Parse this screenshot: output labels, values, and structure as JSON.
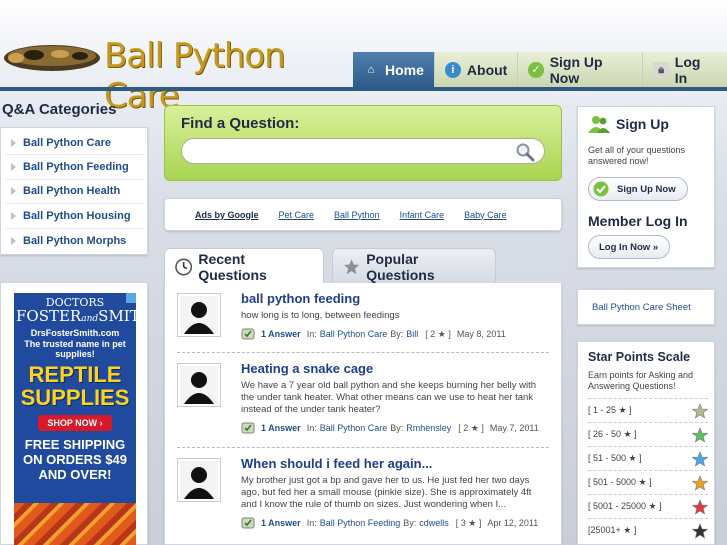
{
  "header": {
    "site_title": "Ball Python Care",
    "nav": [
      {
        "label": "Home",
        "icon": "home-icon",
        "active": true
      },
      {
        "label": "About",
        "icon": "info-icon",
        "active": false
      },
      {
        "label": "Sign Up Now",
        "icon": "check-icon",
        "active": false
      },
      {
        "label": "Log In",
        "icon": "lock-icon",
        "active": false
      }
    ]
  },
  "sidebar": {
    "categories_title": "Q&A Categories",
    "categories": [
      "Ball Python Care",
      "Ball Python Feeding",
      "Ball Python Health",
      "Ball Python Housing",
      "Ball Python Morphs"
    ],
    "ad": {
      "brand_line1": "DOCTORS",
      "brand_line2": "FOSTER",
      "brand_and": "and",
      "brand_line3": "SMITH",
      "url": "DrsFosterSmith.com",
      "tagline": "The trusted name in pet supplies!",
      "headline1": "REPTILE",
      "headline2": "SUPPLIES",
      "shop_button": "SHOP NOW ›",
      "offer": "FREE SHIPPING ON ORDERS $49 AND OVER!"
    }
  },
  "find": {
    "label": "Find a Question:",
    "search_value": ""
  },
  "ads_bar": {
    "ads_by": "Ads by Google",
    "links": [
      "Pet Care",
      "Ball Python",
      "Infant Care",
      "Baby Care"
    ]
  },
  "tabs": {
    "recent": "Recent Questions",
    "popular": "Popular Questions"
  },
  "questions": [
    {
      "title": "ball python feeding",
      "body": "how long is to long, between feedings",
      "answers": "1 Answer",
      "in_label": "In:",
      "category": "Ball Python Care",
      "by_label": "By:",
      "author": "Bill",
      "points": "[ 2 ★ ]",
      "date": "May 8, 2011"
    },
    {
      "title": "Heating a snake cage",
      "body": "We have a 7 year old ball python and she keeps burning her belly with the under tank heater. What other means can we use to heat her tank instead of the under tank heater?",
      "answers": "1 Answer",
      "in_label": "In:",
      "category": "Ball Python Care",
      "by_label": "By:",
      "author": "Rmhensley",
      "points": "[ 2 ★ ]",
      "date": "May 7, 2011"
    },
    {
      "title": "When should i feed her again...",
      "body": "My brother just got a bp and gave her to us. He just fed her two days ago, but fed her a small mouse (pinkie size). She is approximately 4ft and I know the rule of thumb on sizes. Just wondering when I...",
      "answers": "1 Answer",
      "in_label": "In:",
      "category": "Ball Python Feeding",
      "by_label": "By:",
      "author": "cdwells",
      "points": "[ 3 ★ ]",
      "date": "Apr 12, 2011"
    }
  ],
  "signup_box": {
    "title": "Sign Up",
    "text": "Get all of your questions answered now!",
    "button": "Sign Up Now",
    "login_title": "Member Log In",
    "login_button": "Log In Now »"
  },
  "sheet_link": "Ball Python Care Sheet",
  "star_scale": {
    "title": "Star Points Scale",
    "text": "Earn points for Asking and Answering Questions!",
    "levels": [
      {
        "range": "[ 1 - 25 ★ ]",
        "color": "#b8b890"
      },
      {
        "range": "[ 26 - 50 ★ ]",
        "color": "#5cc05c"
      },
      {
        "range": "[ 51 - 500 ★ ]",
        "color": "#4aa8e0"
      },
      {
        "range": "[ 501 - 5000 ★ ]",
        "color": "#f0a020"
      },
      {
        "range": "[ 5001 - 25000 ★ ]",
        "color": "#e03a3a"
      },
      {
        "range": "[25001+ ★ ]",
        "color": "#333333"
      }
    ]
  },
  "colors": {
    "nav_active": "#2e5a8a",
    "find_green": "#a9d451",
    "link_blue": "#1f4d8c"
  }
}
